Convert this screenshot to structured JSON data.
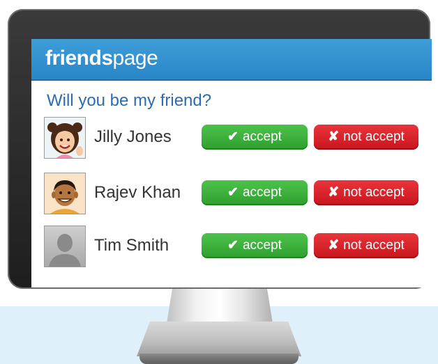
{
  "app": {
    "logo_bold": "friends",
    "logo_light": "page"
  },
  "prompt": "Will you be my friend?",
  "requests": [
    {
      "name": "Jilly Jones",
      "avatar": "girl-avatar",
      "accept_label": "accept",
      "decline_label": "not accept"
    },
    {
      "name": "Rajev Khan",
      "avatar": "boy-avatar",
      "accept_label": "accept",
      "decline_label": "not accept"
    },
    {
      "name": "Tim Smith",
      "avatar": "default-silhouette-avatar",
      "accept_label": "accept",
      "decline_label": "not accept"
    }
  ],
  "icons": {
    "accept": "✔",
    "decline": "✘"
  },
  "colors": {
    "header": "#2a86c8",
    "prompt_text": "#2a6db0",
    "accept": "#3aae38",
    "decline": "#d8222a"
  }
}
